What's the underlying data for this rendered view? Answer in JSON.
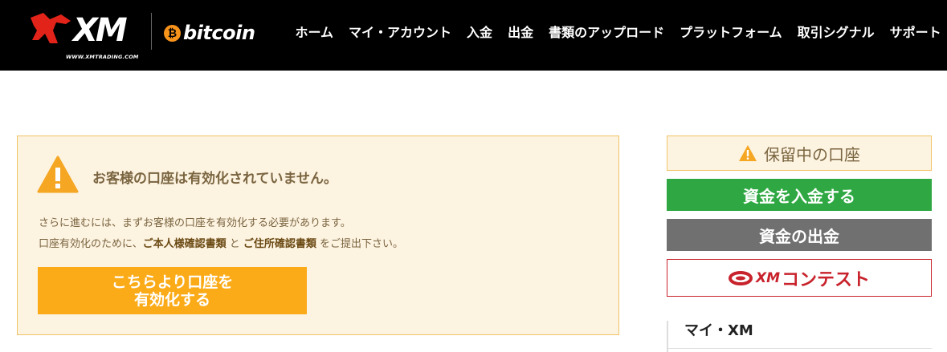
{
  "header": {
    "logo_text": "XM",
    "logo_url": "WWW.XMTRADING.COM",
    "partner": "bitcoin",
    "nav": [
      {
        "label": "ホーム"
      },
      {
        "label": "マイ・アカウント"
      },
      {
        "label": "入金"
      },
      {
        "label": "出金"
      },
      {
        "label": "書類のアップロード"
      },
      {
        "label": "プラットフォーム"
      },
      {
        "label": "取引シグナル"
      },
      {
        "label": "サポート"
      }
    ]
  },
  "alert": {
    "title": "お客様の口座は有効化されていません。",
    "line1": "さらに進むには、まずお客様の口座を有効化する必要があります。",
    "line2_pre": "口座有効化のために、",
    "line2_bold1": "ご本人様確認書類",
    "line2_mid": " と ",
    "line2_bold2": "ご住所確認書類",
    "line2_post": " をご提出下さい。",
    "button_line1": "こちらより口座を",
    "button_line2": "有効化する"
  },
  "sidebar": {
    "pending_label": "保留中の口座",
    "deposit_label": "資金を入金する",
    "withdraw_label": "資金の出金",
    "contest_xm": "XM",
    "contest_label": "コンテスト",
    "myxm_label": "マイ・XM"
  },
  "colors": {
    "header_bg": "#000000",
    "logo_red": "#e2231a",
    "bitcoin_orange": "#f7931a",
    "alert_bg": "#fdf3e1",
    "alert_border": "#f0c466",
    "activate_button": "#fbab18",
    "warning_icon": "#f5a623",
    "deposit_green": "#2fa843",
    "withdraw_gray": "#707070",
    "contest_red": "#c8232c"
  },
  "icons": {
    "alert": "warning-triangle-icon",
    "pending": "warning-triangle-icon",
    "contest": "stadium-ring-icon",
    "bitcoin": "bitcoin-icon"
  }
}
